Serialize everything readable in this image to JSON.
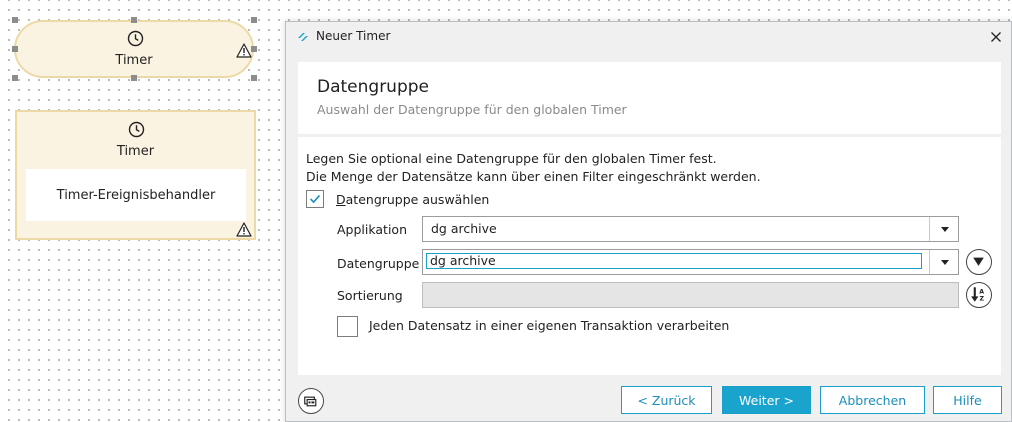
{
  "canvas": {
    "node1": {
      "title": "Timer",
      "icon": "clock-icon",
      "warning_icon": "warning-icon"
    },
    "node2": {
      "title": "Timer",
      "inner_label": "Timer-Ereignisbehandler",
      "icon": "clock-icon",
      "warning_icon": "warning-icon"
    }
  },
  "dialog": {
    "title": "Neuer Timer",
    "header": {
      "title": "Datengruppe",
      "subtitle": "Auswahl der Datengruppe für den globalen Timer"
    },
    "description_line1": "Legen Sie optional eine Datengruppe für den globalen Timer fest.",
    "description_line2": "Die Menge der Datensätze kann über einen Filter eingeschränkt werden.",
    "select_datagroup": {
      "label_first": "D",
      "label_rest": "atengruppe auswählen",
      "checked": true
    },
    "fields": {
      "application": {
        "label": "Applikation",
        "value": "dg archive"
      },
      "datagroup": {
        "label": "Datengruppe",
        "value": "dg archive"
      },
      "sorting": {
        "label": "Sortierung",
        "value": ""
      }
    },
    "transaction_checkbox": {
      "label": "Jeden Datensatz in einer eigenen Transaktion verarbeiten",
      "checked": false
    },
    "buttons": {
      "back": "< Zurück",
      "next": "Weiter >",
      "cancel": "Abbrechen",
      "help": "Hilfe"
    }
  },
  "colors": {
    "accent": "#1aa3cd",
    "node_fill": "#fbf3e1",
    "node_border": "#ecd9a6"
  }
}
